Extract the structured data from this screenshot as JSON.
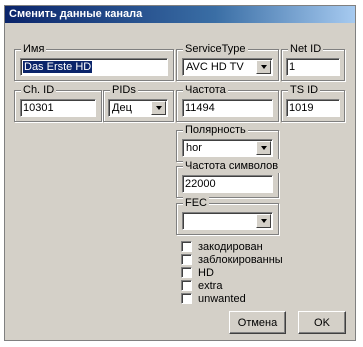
{
  "window": {
    "title": "Сменить данные канала"
  },
  "fields": {
    "name": {
      "label": "Имя",
      "value": "Das Erste HD"
    },
    "service_type": {
      "label": "ServiceType",
      "value": "AVC HD TV"
    },
    "net_id": {
      "label": "Net ID",
      "value": "1"
    },
    "ch_id": {
      "label": "Ch. ID",
      "value": "10301"
    },
    "pids": {
      "label": "PIDs",
      "value": "Дец"
    },
    "frequency": {
      "label": "Частота",
      "value": "11494"
    },
    "ts_id": {
      "label": "TS ID",
      "value": "1019"
    },
    "polarity": {
      "label": "Полярность",
      "value": "hor"
    },
    "symbol_rate": {
      "label": "Частота символов",
      "value": "22000"
    },
    "fec": {
      "label": "FEC",
      "value": ""
    }
  },
  "flags": [
    {
      "label": "закодирован",
      "checked": false
    },
    {
      "label": "заблокированны",
      "checked": false
    },
    {
      "label": "HD",
      "checked": false
    },
    {
      "label": "extra",
      "checked": false
    },
    {
      "label": "unwanted",
      "checked": false
    }
  ],
  "buttons": {
    "cancel": "Отмена",
    "ok": "OK"
  }
}
